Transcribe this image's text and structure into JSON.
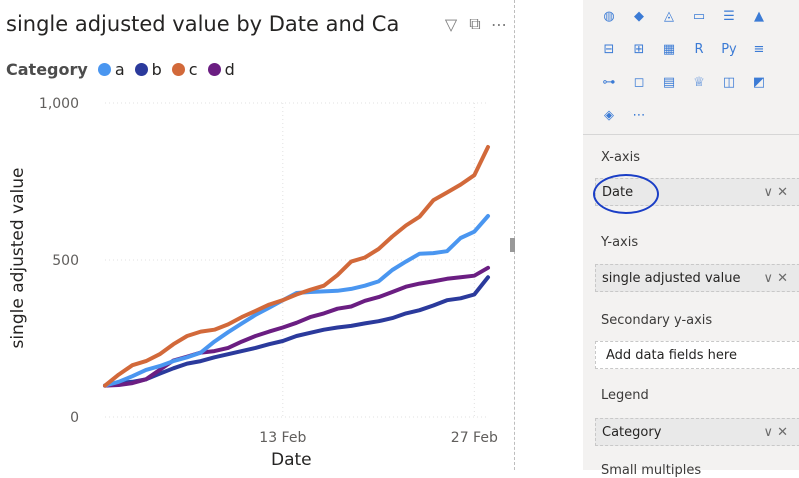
{
  "visual": {
    "title": "single adjusted value by Date and Ca",
    "header_icons": {
      "filter": "▽",
      "focus": "⧉",
      "more": "⋯"
    },
    "legend_title": "Category",
    "colors": {
      "a": "#4a96f0",
      "b": "#2b3a9c",
      "c": "#d2693a",
      "d": "#6b1e82",
      "grid": "#e1e1e1",
      "axis_text": "#605e5c"
    }
  },
  "chart_data": {
    "type": "line",
    "xlabel": "Date",
    "ylabel": "single adjusted value",
    "ylim": [
      0,
      1000
    ],
    "yticks": [
      "0",
      "500",
      "1,000"
    ],
    "xticks": [
      "13 Feb",
      "27 Feb"
    ],
    "x": [
      "2024-01-31",
      "2024-02-01",
      "2024-02-02",
      "2024-02-03",
      "2024-02-04",
      "2024-02-05",
      "2024-02-06",
      "2024-02-07",
      "2024-02-08",
      "2024-02-09",
      "2024-02-10",
      "2024-02-11",
      "2024-02-12",
      "2024-02-13",
      "2024-02-14",
      "2024-02-15",
      "2024-02-16",
      "2024-02-17",
      "2024-02-18",
      "2024-02-19",
      "2024-02-20",
      "2024-02-21",
      "2024-02-22",
      "2024-02-23",
      "2024-02-24",
      "2024-02-25",
      "2024-02-26",
      "2024-02-27",
      "2024-02-28"
    ],
    "series": [
      {
        "name": "a",
        "values": [
          100,
          112,
          130,
          150,
          162,
          178,
          190,
          205,
          240,
          270,
          298,
          325,
          348,
          372,
          395,
          398,
          400,
          402,
          408,
          418,
          432,
          468,
          495,
          520,
          522,
          528,
          570,
          590,
          640
        ]
      },
      {
        "name": "b",
        "values": [
          100,
          108,
          112,
          120,
          138,
          155,
          170,
          178,
          190,
          200,
          210,
          220,
          232,
          242,
          258,
          268,
          278,
          285,
          290,
          298,
          305,
          315,
          330,
          340,
          355,
          372,
          378,
          390,
          445
        ]
      },
      {
        "name": "c",
        "values": [
          100,
          135,
          165,
          178,
          200,
          232,
          258,
          272,
          278,
          295,
          318,
          338,
          358,
          372,
          390,
          405,
          418,
          452,
          495,
          508,
          535,
          575,
          610,
          638,
          690,
          715,
          740,
          770,
          860
        ]
      },
      {
        "name": "d",
        "values": [
          100,
          102,
          108,
          120,
          150,
          180,
          192,
          205,
          210,
          220,
          240,
          258,
          272,
          285,
          300,
          318,
          330,
          345,
          352,
          370,
          382,
          398,
          415,
          425,
          432,
          440,
          445,
          450,
          475
        ]
      }
    ]
  },
  "pane": {
    "icon_rows": [
      [
        "map-icon",
        "filled-map-icon",
        "shape-map-icon",
        "card-icon",
        "multi-row-card-icon",
        "kpi-icon"
      ],
      [
        "slicer-icon",
        "table-icon",
        "matrix-icon",
        "r-visual-icon",
        "python-visual-icon",
        "key-influencers-icon"
      ],
      [
        "decomposition-tree-icon",
        "qna-icon",
        "smart-narrative-icon",
        "trophy-icon",
        "paginated-report-icon",
        "power-apps-icon"
      ],
      [
        "power-automate-icon",
        "more-visuals-icon"
      ]
    ],
    "glyphs": {
      "map-icon": "◍",
      "filled-map-icon": "◆",
      "shape-map-icon": "◬",
      "card-icon": "▭",
      "multi-row-card-icon": "☰",
      "kpi-icon": "▲",
      "slicer-icon": "⊟",
      "table-icon": "⊞",
      "matrix-icon": "▦",
      "r-visual-icon": "R",
      "python-visual-icon": "Py",
      "key-influencers-icon": "≡",
      "decomposition-tree-icon": "⊶",
      "qna-icon": "◻",
      "smart-narrative-icon": "▤",
      "trophy-icon": "♕",
      "paginated-report-icon": "◫",
      "power-apps-icon": "◩",
      "power-automate-icon": "◈",
      "more-visuals-icon": "⋯"
    },
    "xaxis_label": "X-axis",
    "xaxis_value": "Date",
    "yaxis_label": "Y-axis",
    "yaxis_value": "single adjusted value",
    "secondary_label": "Secondary y-axis",
    "secondary_placeholder": "Add data fields here",
    "legend_label": "Legend",
    "legend_value": "Category",
    "small_multiples_label": "Small multiples",
    "well_controls": "∨ ✕"
  }
}
